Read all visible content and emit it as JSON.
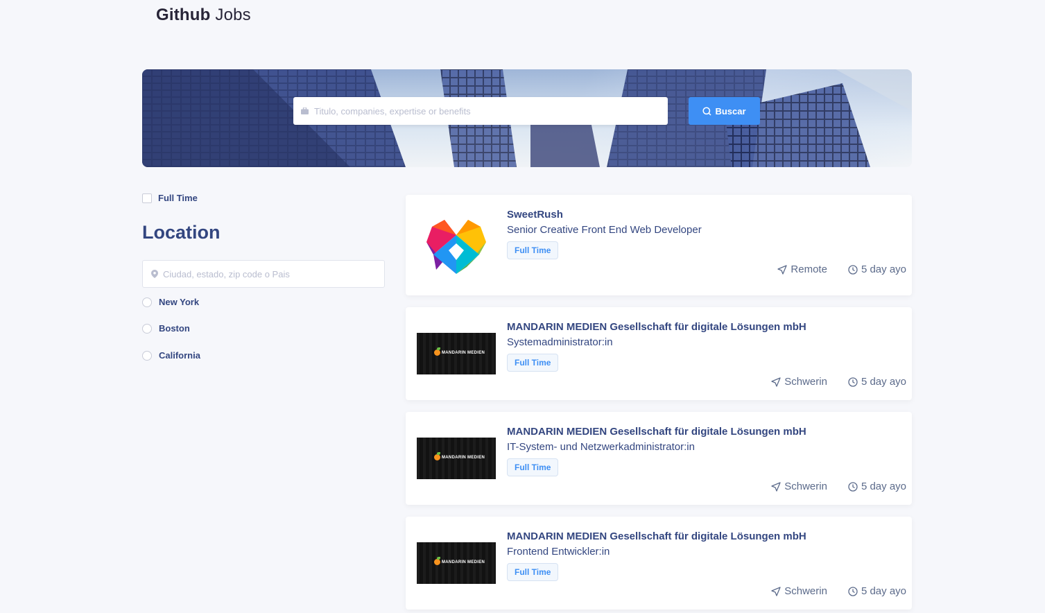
{
  "brand": {
    "bold": "Github",
    "light": "Jobs"
  },
  "search": {
    "placeholder": "Titulo, companies, expertise or benefits",
    "button_label": "Buscar"
  },
  "filters": {
    "full_time_label": "Full Time",
    "location_title": "Location",
    "location_placeholder": "Ciudad, estado, zip code o Pais",
    "locations": [
      "New York",
      "Boston",
      "California"
    ]
  },
  "jobs": [
    {
      "company": "SweetRush",
      "title": "Senior Creative Front End Web Developer",
      "type": "Full Time",
      "location": "Remote",
      "posted": "5 day ayo",
      "logo": "sweetrush-heart-logo"
    },
    {
      "company": "MANDARIN MEDIEN Gesellschaft für digitale Lösungen mbH",
      "title": "Systemadministrator:in",
      "type": "Full Time",
      "location": "Schwerin",
      "posted": "5 day ayo",
      "logo": "mandarin-medien-logo"
    },
    {
      "company": "MANDARIN MEDIEN Gesellschaft für digitale Lösungen mbH",
      "title": "IT-System- und Netzwerkadministrator:in",
      "type": "Full Time",
      "location": "Schwerin",
      "posted": "5 day ayo",
      "logo": "mandarin-medien-logo"
    },
    {
      "company": "MANDARIN MEDIEN Gesellschaft für digitale Lösungen mbH",
      "title": "Frontend Entwickler:in",
      "type": "Full Time",
      "location": "Schwerin",
      "posted": "5 day ayo",
      "logo": "mandarin-medien-logo"
    }
  ],
  "mandarin_logo_text": "MANDARIN MEDIEN",
  "colors": {
    "accent": "#3e8ff4",
    "text": "#334680",
    "background": "#f6f7fb"
  }
}
